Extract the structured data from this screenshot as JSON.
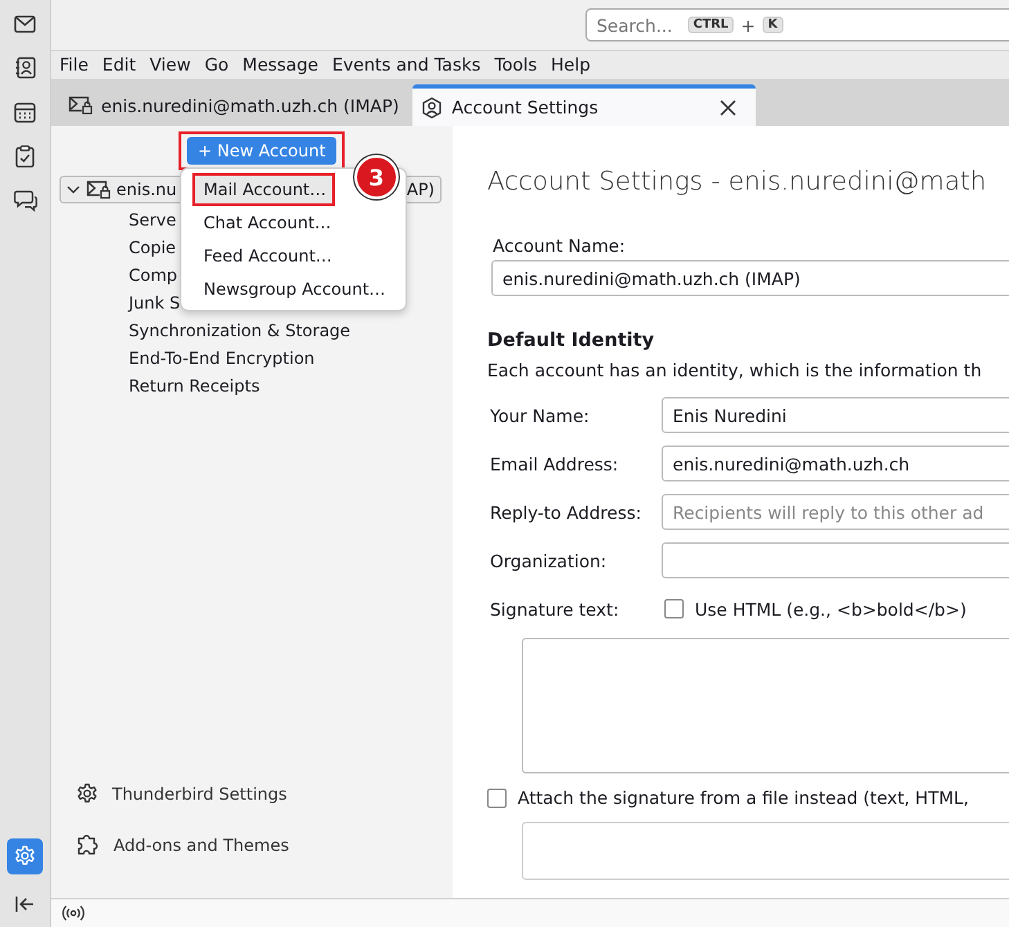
{
  "spaces_toolbar": {
    "items": [
      {
        "kind": "mail",
        "selected": false
      },
      {
        "kind": "contacts",
        "selected": false
      },
      {
        "kind": "calendar",
        "selected": false
      },
      {
        "kind": "tasks",
        "selected": false
      },
      {
        "kind": "chat",
        "selected": false
      }
    ],
    "bottom_items": [
      {
        "kind": "settings",
        "selected": true
      },
      {
        "kind": "collapse",
        "selected": false
      }
    ]
  },
  "search": {
    "placeholder": "Search...",
    "shortcut_keys": [
      "CTRL",
      "K"
    ],
    "shortcut_joiner": "+"
  },
  "menu_bar": [
    "File",
    "Edit",
    "View",
    "Go",
    "Message",
    "Events and Tasks",
    "Tools",
    "Help"
  ],
  "tabs": [
    {
      "kind": "mail",
      "label": "enis.nuredini@math.uzh.ch (IMAP)",
      "selected": false
    },
    {
      "kind": "settings",
      "label": "Account Settings",
      "selected": true
    }
  ],
  "new_account_button": {
    "label": "+ New Account",
    "highlighted": true
  },
  "account_tree": {
    "label_start": "enis.nu",
    "label_end": "AP)",
    "expanded": true,
    "children": [
      "Serve",
      "Copie",
      "Comp",
      "Junk S",
      "Synchronization & Storage",
      "End-To-End Encryption",
      "Return Receipts"
    ]
  },
  "new_account_menu": [
    {
      "label": "Mail Account…",
      "selected": true,
      "highlighted": true
    },
    {
      "label": "Chat Account…",
      "selected": false,
      "highlighted": false
    },
    {
      "label": "Feed Account…",
      "selected": false,
      "highlighted": false
    },
    {
      "label": "Newsgroup Account…",
      "selected": false,
      "highlighted": false
    }
  ],
  "step_badge": "3",
  "left_footer": [
    {
      "kind": "gear",
      "label": "Thunderbird Settings"
    },
    {
      "kind": "puzzle",
      "label": "Add-ons and Themes"
    }
  ],
  "panel": {
    "title": "Account Settings - enis.nuredini@math",
    "account_name_label": "Account Name:",
    "account_name": "enis.nuredini@math.uzh.ch (IMAP)",
    "section_title": "Default Identity",
    "section_description": "Each account has an identity, which is the information th",
    "fields": [
      {
        "label": "Your Name:",
        "value": "Enis Nuredini"
      },
      {
        "label": "Email Address:",
        "value": "enis.nuredini@math.uzh.ch"
      },
      {
        "label": "Reply-to Address:",
        "placeholder": "Recipients will reply to this other ad"
      },
      {
        "label": "Organization:"
      }
    ],
    "signature": {
      "label": "Signature text:",
      "use_html_label": "Use HTML (e.g., <b>bold</b>)",
      "use_html_checked": false
    },
    "attach": {
      "label": "Attach the signature from a file instead (text, HTML,",
      "checked": false
    }
  }
}
